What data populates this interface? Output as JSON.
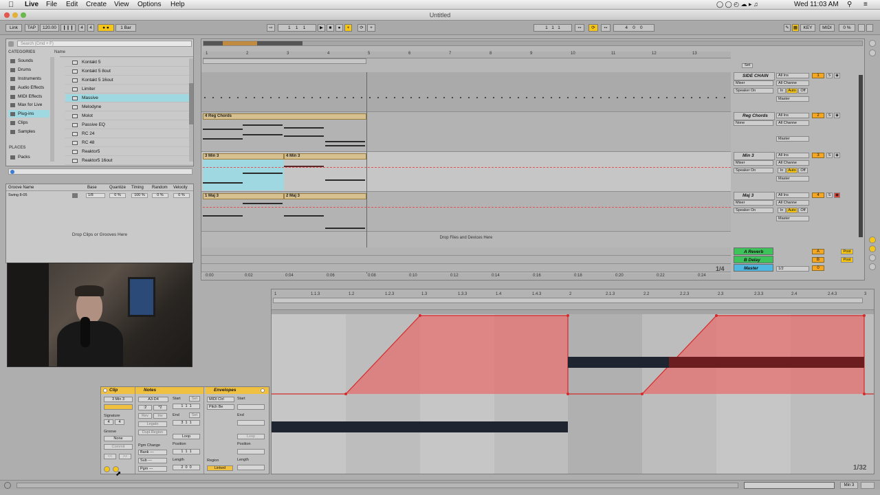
{
  "menubar": {
    "apple_icon": "apple-icon",
    "app_name": "Live",
    "items": [
      "File",
      "Edit",
      "Create",
      "View",
      "Options",
      "Help"
    ],
    "clock": "Wed 11:03 AM"
  },
  "window": {
    "title": "Untitled"
  },
  "transport": {
    "link": "Link",
    "tap": "TAP",
    "tempo": "120.00",
    "sig_num": "4",
    "sig_den": "4",
    "quantize": "1 Bar",
    "pos": [
      "1",
      "1",
      "1"
    ],
    "loop_start": [
      "1",
      "1",
      "1"
    ],
    "loop_len": [
      "4",
      "0",
      "0"
    ],
    "key": "KEY",
    "midi": "MIDI",
    "cpu": "0 %"
  },
  "browser": {
    "search_placeholder": "Search (Cmd + F)",
    "categories_title": "CATEGORIES",
    "categories": [
      "Sounds",
      "Drums",
      "Instruments",
      "Audio Effects",
      "MIDI Effects",
      "Max for Live",
      "Plug-ins",
      "Clips",
      "Samples"
    ],
    "selected_category": "Plug-ins",
    "places_title": "PLACES",
    "places": [
      "Packs"
    ],
    "name_header": "Name",
    "items": [
      "Kontakt 5",
      "Kontakt 5 8out",
      "Kontakt 5 16out",
      "Limiter",
      "Massive",
      "Melodyne",
      "Molot",
      "Passive EQ",
      "RC 24",
      "RC 48",
      "Reaktor5",
      "Reaktor5 16out"
    ],
    "selected_item": "Massive"
  },
  "groove": {
    "headers": [
      "Groove Name",
      "Base",
      "Quantize",
      "Timing",
      "Random",
      "Velocity"
    ],
    "row": {
      "name": "Swing 8-05",
      "base": "1/8",
      "quantize": "0 %",
      "timing": "100 %",
      "random": "0 %",
      "velocity": "0 %"
    },
    "drop_text": "Drop Clips or Grooves Here"
  },
  "arrangement": {
    "bar_ruler": [
      "1",
      "2",
      "3",
      "4",
      "5",
      "6",
      "7",
      "8",
      "9",
      "10",
      "11",
      "12",
      "13"
    ],
    "time_ruler": [
      "0:00",
      "0:02",
      "0:04",
      "0:06",
      "0:08",
      "0:10",
      "0:12",
      "0:14",
      "0:16",
      "0:18",
      "0:20",
      "0:22",
      "0:24"
    ],
    "set_button": "Set",
    "drop_files": "Drop Files and Devices Here",
    "zoom": "1/4",
    "tracks": [
      {
        "name": "SIDE CHAIN",
        "input": "All Ins",
        "channel": "All Channe",
        "device": "Mixer",
        "output": "Speaker On",
        "master": "Master",
        "number": "1",
        "num_color": "#f5a623"
      },
      {
        "name": "Reg Chords",
        "input": "All Ins",
        "channel": "All Channe",
        "device": "None",
        "output": "",
        "master": "Master",
        "number": "2",
        "num_color": "#f5a623"
      },
      {
        "name": "Min 3",
        "input": "All Ins",
        "channel": "All Channe",
        "device": "Mixer",
        "output": "Speaker On",
        "master": "Master",
        "number": "3",
        "num_color": "#f5a623"
      },
      {
        "name": "Maj 3",
        "input": "All Ins",
        "channel": "All Channe",
        "device": "Mixer",
        "output": "Speaker On",
        "master": "Master",
        "number": "4",
        "num_color": "#f5a623"
      }
    ],
    "returns": [
      {
        "name": "A Reverb",
        "letter": "A",
        "post": "Post",
        "color": "#3ec25a"
      },
      {
        "name": "B Delay",
        "letter": "B",
        "post": "Post",
        "color": "#3ec25a"
      },
      {
        "name": "Master",
        "letter": "0",
        "post": "",
        "color": "#4fb8e0"
      }
    ],
    "master_ratio": "1/2",
    "clips": {
      "reg_chords": "4 Reg Chords",
      "min3_a": "3 Min 3",
      "min3_b": "4 Min 3",
      "maj3_a": "1 Maj 3",
      "maj3_b": "2 Maj 3"
    },
    "mute_labels": {
      "in": "In",
      "auto": "Auto",
      "off": "Off",
      "s": "S",
      "c": "C",
      "inf": "-inf"
    }
  },
  "detail": {
    "clip": {
      "title": "Clip",
      "name": "3 Min 3",
      "signature_label": "Signature",
      "sig": [
        "4",
        "4"
      ],
      "groove_label": "Groove",
      "groove_value": "None",
      "commit": "Commit"
    },
    "notes": {
      "title": "Notes",
      "range": "A3-D4",
      "start_label": "Start",
      "set": "Set",
      "end_label": "End",
      "rev": "Rev",
      "inv": "Inv",
      "legato": "Legato",
      "dupl": "Dupl.Region",
      "loop": "Loop",
      "position_label": "Position",
      "length_label": "Length",
      "pgm_change": "Pgm Change",
      "bank": "Bank ---",
      "sub": "Sub ---",
      "pgm": "Pgm ---",
      "start_val": [
        "1",
        "1",
        "1"
      ],
      "end_val": [
        "3",
        "1",
        "1"
      ],
      "pos_val": [
        "1",
        "1",
        "1"
      ],
      "len_val": [
        "2",
        "0",
        "0"
      ],
      "half": ":2",
      "double": "*2"
    },
    "envelopes": {
      "title": "Envelopes",
      "source": "MIDI Ctrl",
      "control": "Pitch Be",
      "start_label": "Start",
      "end_label": "End",
      "loop": "Loop",
      "position_label": "Position",
      "length_label": "Length",
      "region_label": "Region",
      "linked": "Linked"
    }
  },
  "piano": {
    "ruler": [
      "1",
      "1.1.3",
      "1.2",
      "1.2.3",
      "1.3",
      "1.3.3",
      "1.4",
      "1.4.3",
      "2",
      "2.1.3",
      "2.2",
      "2.2.3",
      "2.3",
      "2.3.3",
      "2.4",
      "2.4.3",
      "3"
    ],
    "grid": "1/32",
    "envelope_color": "#e86a6a",
    "note_color": "#1e2430"
  },
  "statusbar": {
    "track_label": "Min 3"
  },
  "colors": {
    "accent": "#f5c518",
    "clip": "#d6c08f",
    "selected": "#9fd8e0",
    "envelope": "#e86a6a"
  }
}
